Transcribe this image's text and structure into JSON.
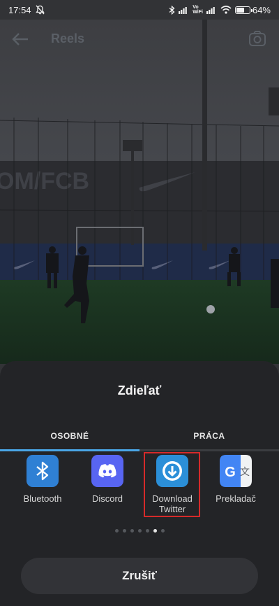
{
  "status_bar": {
    "time": "17:54",
    "vowifi_top": "Vo",
    "vowifi_bottom": "WiFi",
    "battery_percent": "64%",
    "battery_level": 0.64,
    "icons": [
      "mute-icon",
      "bluetooth-icon",
      "signal-icon",
      "wifi-icon",
      "battery-icon"
    ]
  },
  "header": {
    "title": "Reels",
    "back_icon": "arrow-left-icon",
    "camera_icon": "camera-icon"
  },
  "scene": {
    "banner_text": "OM/FCB"
  },
  "share_sheet": {
    "title": "Zdieľať",
    "tabs": [
      {
        "label": "OSOBNÉ",
        "active": true
      },
      {
        "label": "PRÁCA",
        "active": false
      }
    ],
    "apps": [
      {
        "name": "Bluetooth",
        "line2": "",
        "icon": "bluetooth-app-icon",
        "color": "#2f80d4"
      },
      {
        "name": "Discord",
        "line2": "",
        "icon": "discord-app-icon",
        "color": "#5865f2"
      },
      {
        "name": "Download",
        "line2": "Twitter",
        "icon": "download-app-icon",
        "color": "#2b8fd8"
      },
      {
        "name": "Prekladač",
        "line2": "",
        "icon": "translate-app-icon",
        "color": "#e9ecef"
      }
    ],
    "page_dots": 7,
    "active_page": 5,
    "cancel_label": "Zrušiť"
  },
  "colors": {
    "accent": "#4aa6e6",
    "highlight": "#d62a2a",
    "sheet_bg": "#232427"
  }
}
